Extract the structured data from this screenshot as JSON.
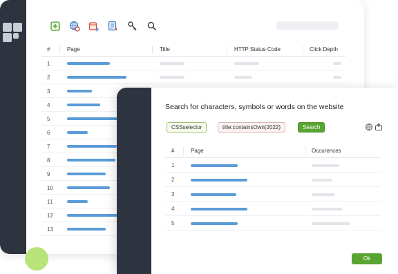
{
  "back_window": {
    "toolbar": {
      "icons": [
        "add-icon",
        "globe-settings-icon",
        "calendar-export-icon",
        "list-export-icon",
        "key-icon",
        "search-icon"
      ]
    },
    "table": {
      "columns": [
        "#",
        "Page",
        "Title",
        "HTTP Status Code",
        "Click Depth"
      ],
      "row_numbers": [
        "1",
        "2",
        "3",
        "4",
        "5",
        "6",
        "7",
        "8",
        "9",
        "10",
        "11",
        "12",
        "13"
      ]
    }
  },
  "dialog": {
    "title": "Search for characters, symbols or words on the website",
    "chip_css": "CSSselector",
    "chip_query": "title:containsOwn(2022)",
    "search_button": "Search",
    "icons": [
      "globe-icon",
      "export-icon"
    ],
    "table": {
      "columns": [
        "#",
        "Page",
        "Occurences"
      ],
      "row_numbers": [
        "1",
        "2",
        "3",
        "4",
        "5"
      ]
    },
    "ok_button": "Ok"
  },
  "colors": {
    "sidebar": "#2d3440",
    "accent_green": "#5aa532",
    "link_blue": "#5a9bd8",
    "placeholder_grey": "#e2e5e9"
  }
}
